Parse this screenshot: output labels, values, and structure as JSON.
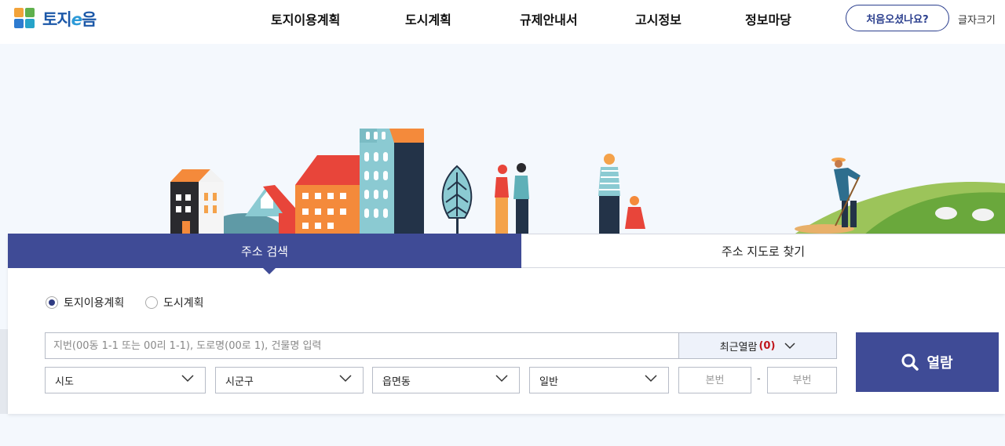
{
  "header": {
    "logo_text_a": "토지",
    "logo_text_e": "e",
    "logo_text_b": "음",
    "nav": [
      {
        "label": "토지이용계획"
      },
      {
        "label": "도시계획"
      },
      {
        "label": "규제안내서"
      },
      {
        "label": "고시정보"
      },
      {
        "label": "정보마당"
      }
    ],
    "first_visit_label": "처음오셨나요?",
    "font_size_label": "글자크기"
  },
  "search": {
    "tabs": [
      {
        "label": "주소 검색",
        "active": true
      },
      {
        "label": "주소 지도로 찾기",
        "active": false
      }
    ],
    "radios": [
      {
        "label": "토지이용계획",
        "checked": true
      },
      {
        "label": "도시계획",
        "checked": false
      }
    ],
    "input_placeholder": "지번(00동 1-1 또는 00리 1-1), 도로명(00로 1), 건물명 입력",
    "recent_label": "최근열람",
    "recent_count": "(0)",
    "selects": [
      {
        "value": "시도"
      },
      {
        "value": "시군구"
      },
      {
        "value": "읍면동"
      },
      {
        "value": "일반"
      }
    ],
    "main_no_placeholder": "본번",
    "sub_no_placeholder": "부번",
    "dash": "-",
    "view_button_label": "열람"
  },
  "colors": {
    "primary": "#3f4b96",
    "logo_blue": "#1c58a8",
    "count_red": "#c0161c",
    "hero_bg": "#f4f8fd"
  },
  "icons": [
    "logo-mark-icon",
    "chevron-down-icon",
    "search-icon",
    "radio-icon"
  ]
}
